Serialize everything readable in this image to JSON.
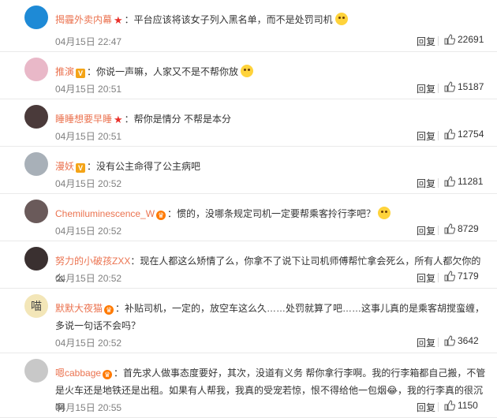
{
  "comments": [
    {
      "user": "揭霾外卖内幕",
      "badge": "star",
      "text": "：平台应该将该女子列入黑名单，而不是处罚司机",
      "emoji": true,
      "time": "04月15日 22:47",
      "reply": "回复",
      "likes": "22691",
      "avatar_color": "#1e8ad6"
    },
    {
      "user": "推演",
      "badge": "v",
      "text": "：你说一声嘛，人家又不是不帮你放",
      "emoji": true,
      "time": "04月15日 20:51",
      "reply": "回复",
      "likes": "15187",
      "avatar_color": "#e9b8c8"
    },
    {
      "user": "睡睡想要早睡",
      "badge": "star",
      "text": "：帮你是情分  不帮是本分",
      "emoji": false,
      "time": "04月15日 20:51",
      "reply": "回复",
      "likes": "12754",
      "avatar_color": "#4a3a3a"
    },
    {
      "user": "漫妖",
      "badge": "v",
      "text": "：没有公主命得了公主病吧",
      "emoji": false,
      "time": "04月15日 20:52",
      "reply": "回复",
      "likes": "11281",
      "avatar_color": "#a8b0b8"
    },
    {
      "user": "Chemiluminescence_W",
      "badge": "vip",
      "text": "：惯的，没哪条规定司机一定要帮乘客拎行李吧？",
      "emoji": true,
      "time": "04月15日 20:52",
      "reply": "回复",
      "likes": "8729",
      "avatar_color": "#6a5a5a"
    },
    {
      "user": "努力的小破孩ZXX",
      "badge": "",
      "text": "：现在人都这么矫情了么，你拿不了说下让司机师傅帮忙拿会死么，所有人都欠你的么",
      "emoji": false,
      "time": "04月15日 20:52",
      "reply": "回复",
      "likes": "7179",
      "avatar_color": "#3a3030"
    },
    {
      "user": "默默大夜猫",
      "badge": "vip",
      "text": "：补贴司机，一定的，放空车这么久……处罚就算了吧……这事儿真的是乘客胡搅蛮缠，多说一句话不会吗？",
      "emoji": false,
      "time": "04月15日 20:52",
      "reply": "回复",
      "likes": "3642",
      "avatar_color": "#f3e6b8",
      "avatar_label": "喵"
    },
    {
      "user": "嗯cabbage",
      "badge": "vip",
      "text": "：首先求人做事态度要好，其次，没道有义务 帮你拿行李啊。我的行李箱都自己搬，不管是火车还是地铁还是出租。如果有人帮我，我真的受宠若惊，恨不得给他一包烟😂，我的行李真的很沉啊",
      "emoji": false,
      "time": "04月15日 20:55",
      "reply": "回复",
      "likes": "1150",
      "avatar_color": "#c8c8c8"
    }
  ]
}
